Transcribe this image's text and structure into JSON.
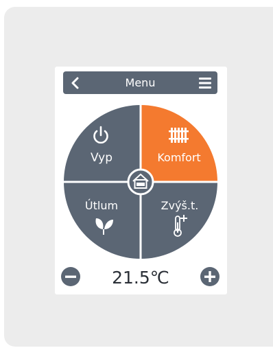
{
  "header": {
    "title": "Menu"
  },
  "modes": {
    "off": {
      "label": "Vyp"
    },
    "comfort": {
      "label": "Komfort"
    },
    "reduced": {
      "label": "Útlum"
    },
    "boost": {
      "label": "Zvýš.t."
    }
  },
  "temperature": {
    "value": "21.5℃"
  },
  "colors": {
    "panel": "#5b6674",
    "active": "#f47a2f",
    "device": "#ececec"
  },
  "icons": {
    "back": "chevron-left-icon",
    "menu": "hamburger-icon",
    "off": "power-icon",
    "comfort": "radiator-icon",
    "reduced": "leaf-icon",
    "boost": "thermometer-plus-icon",
    "home": "house-icon",
    "decrease": "minus-icon",
    "increase": "plus-icon"
  }
}
